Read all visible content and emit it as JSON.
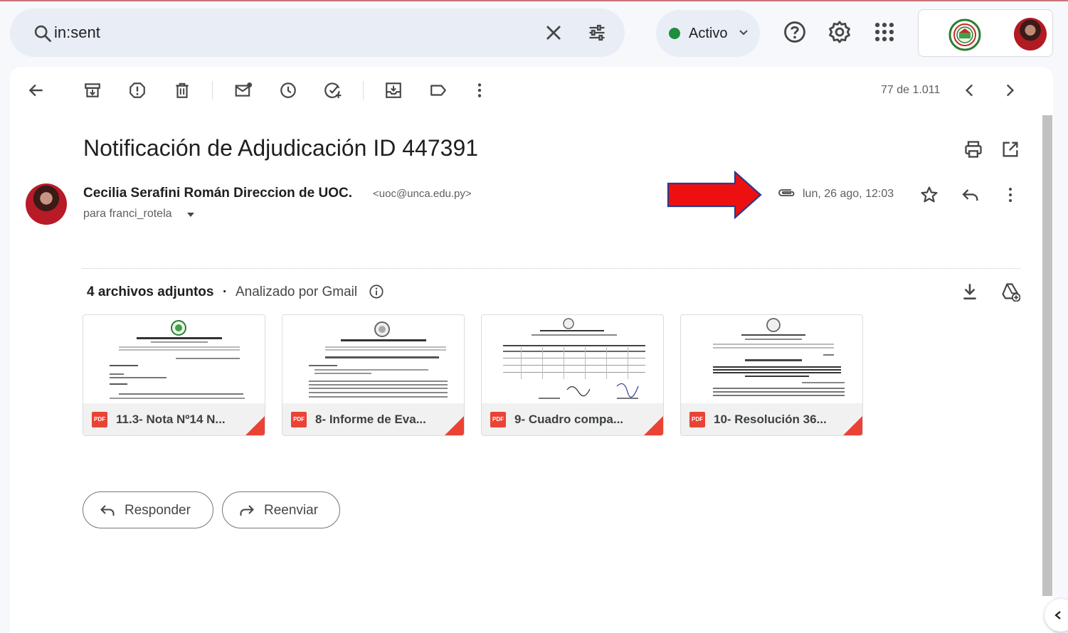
{
  "search": {
    "query": "in:sent"
  },
  "status": {
    "label": "Activo",
    "color": "#1e8e3e"
  },
  "toolbar": {
    "counter": "77 de 1.011"
  },
  "message": {
    "subject": "Notificación de Adjudicación ID 447391",
    "sender_name": "Cecilia Serafini Román Direccion de UOC.",
    "sender_email": "<uoc@unca.edu.py>",
    "recipient": "para franci_rotela",
    "date": "lun, 26 ago, 12:03"
  },
  "attachments": {
    "count_label": "4 archivos adjuntos",
    "scan_label": "Analizado por Gmail",
    "items": [
      {
        "name": "11.3- Nota Nº14 N...",
        "badge": "PDF"
      },
      {
        "name": "8- Informe de Eva...",
        "badge": "PDF"
      },
      {
        "name": "9- Cuadro compa...",
        "badge": "PDF"
      },
      {
        "name": "10- Resolución 36...",
        "badge": "PDF"
      }
    ]
  },
  "actions": {
    "reply": "Responder",
    "forward": "Reenviar"
  },
  "colors": {
    "accent_red": "#ea4335",
    "annotation_arrow": "#ee1010"
  }
}
